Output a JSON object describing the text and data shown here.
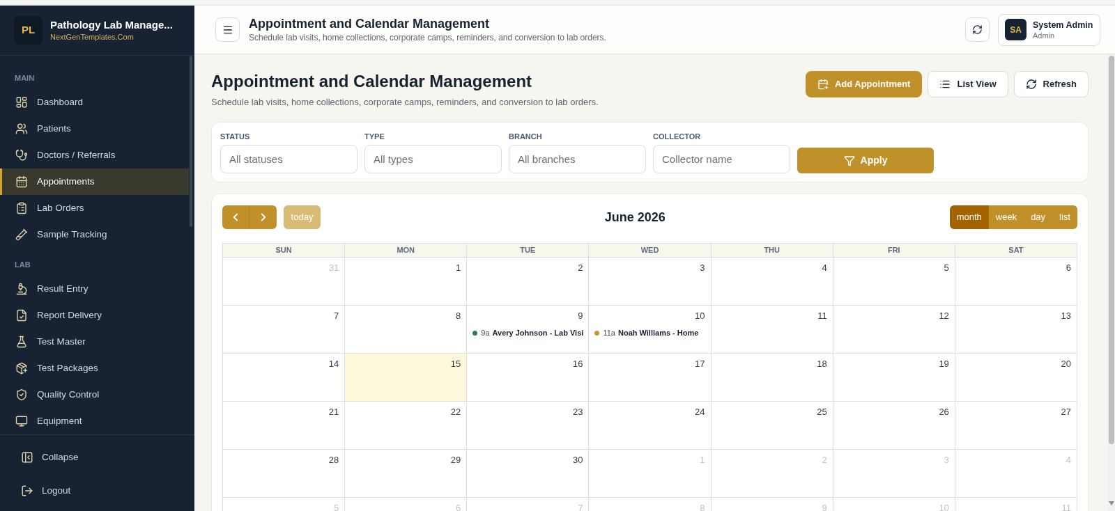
{
  "sidebar": {
    "logo": {
      "initials": "PL",
      "title": "Pathology Lab Manage...",
      "subtitle": "NextGenTemplates.Com"
    },
    "sections": [
      {
        "label": "MAIN",
        "items": [
          {
            "label": "Dashboard",
            "selected": false
          },
          {
            "label": "Patients",
            "selected": false
          },
          {
            "label": "Doctors / Referrals",
            "selected": false
          },
          {
            "label": "Appointments",
            "selected": true
          },
          {
            "label": "Lab Orders",
            "selected": false
          },
          {
            "label": "Sample Tracking",
            "selected": false
          }
        ]
      },
      {
        "label": "LAB",
        "items": [
          {
            "label": "Result Entry",
            "selected": false
          },
          {
            "label": "Report Delivery",
            "selected": false
          },
          {
            "label": "Test Master",
            "selected": false
          },
          {
            "label": "Test Packages",
            "selected": false
          },
          {
            "label": "Quality Control",
            "selected": false
          },
          {
            "label": "Equipment",
            "selected": false
          }
        ]
      }
    ],
    "footer": [
      {
        "label": "Collapse"
      },
      {
        "label": "Logout"
      }
    ]
  },
  "header": {
    "title": "Appointment and Calendar Management",
    "subtitle": "Schedule lab visits, home collections, corporate camps, reminders, and conversion to lab orders.",
    "user": {
      "initials": "SA",
      "name": "System Admin",
      "role": "Admin"
    }
  },
  "page": {
    "title": "Appointment and Calendar Management",
    "subtitle": "Schedule lab visits, home collections, corporate camps, reminders, and conversion to lab orders.",
    "actions": [
      {
        "label": "Add Appointment",
        "kind": "primary"
      },
      {
        "label": "List View",
        "kind": "secondary"
      },
      {
        "label": "Refresh",
        "kind": "secondary"
      }
    ]
  },
  "filters": {
    "fields": [
      {
        "label": "STATUS",
        "placeholder": "All statuses"
      },
      {
        "label": "TYPE",
        "placeholder": "All types"
      },
      {
        "label": "BRANCH",
        "placeholder": "All branches"
      },
      {
        "label": "COLLECTOR",
        "placeholder": "Collector name"
      }
    ],
    "apply": "Apply"
  },
  "calendar": {
    "title": "June 2026",
    "today_button": {
      "label": "today",
      "disabled": true
    },
    "views": [
      {
        "label": "month",
        "selected": true
      },
      {
        "label": "week",
        "selected": false
      },
      {
        "label": "day",
        "selected": false
      },
      {
        "label": "list",
        "selected": false
      }
    ],
    "weekdays": [
      "SUN",
      "MON",
      "TUE",
      "WED",
      "THU",
      "FRI",
      "SAT"
    ],
    "weeks": [
      [
        {
          "date": "31",
          "other_month": true,
          "today": false
        },
        {
          "date": "1",
          "other_month": false,
          "today": false
        },
        {
          "date": "2",
          "other_month": false,
          "today": false
        },
        {
          "date": "3",
          "other_month": false,
          "today": false
        },
        {
          "date": "4",
          "other_month": false,
          "today": false
        },
        {
          "date": "5",
          "other_month": false,
          "today": false
        },
        {
          "date": "6",
          "other_month": false,
          "today": false
        }
      ],
      [
        {
          "date": "7",
          "other_month": false,
          "today": false
        },
        {
          "date": "8",
          "other_month": false,
          "today": false
        },
        {
          "date": "9",
          "other_month": false,
          "today": false,
          "events": [
            {
              "time": "9a",
              "title": "Avery Johnson - Lab Visi",
              "color": "#2e7d5e"
            }
          ]
        },
        {
          "date": "10",
          "other_month": false,
          "today": false,
          "events": [
            {
              "time": "11a",
              "title": "Noah Williams - Home",
              "color": "#c9992f"
            }
          ]
        },
        {
          "date": "11",
          "other_month": false,
          "today": false
        },
        {
          "date": "12",
          "other_month": false,
          "today": false
        },
        {
          "date": "13",
          "other_month": false,
          "today": false
        }
      ],
      [
        {
          "date": "14",
          "other_month": false,
          "today": false
        },
        {
          "date": "15",
          "other_month": false,
          "today": true
        },
        {
          "date": "16",
          "other_month": false,
          "today": false
        },
        {
          "date": "17",
          "other_month": false,
          "today": false
        },
        {
          "date": "18",
          "other_month": false,
          "today": false
        },
        {
          "date": "19",
          "other_month": false,
          "today": false
        },
        {
          "date": "20",
          "other_month": false,
          "today": false
        }
      ],
      [
        {
          "date": "21",
          "other_month": false,
          "today": false
        },
        {
          "date": "22",
          "other_month": false,
          "today": false
        },
        {
          "date": "23",
          "other_month": false,
          "today": false
        },
        {
          "date": "24",
          "other_month": false,
          "today": false
        },
        {
          "date": "25",
          "other_month": false,
          "today": false
        },
        {
          "date": "26",
          "other_month": false,
          "today": false
        },
        {
          "date": "27",
          "other_month": false,
          "today": false
        }
      ],
      [
        {
          "date": "28",
          "other_month": false,
          "today": false
        },
        {
          "date": "29",
          "other_month": false,
          "today": false
        },
        {
          "date": "30",
          "other_month": false,
          "today": false
        },
        {
          "date": "1",
          "other_month": true,
          "today": false
        },
        {
          "date": "2",
          "other_month": true,
          "today": false
        },
        {
          "date": "3",
          "other_month": true,
          "today": false
        },
        {
          "date": "4",
          "other_month": true,
          "today": false
        }
      ],
      [
        {
          "date": "5",
          "other_month": true,
          "today": false
        },
        {
          "date": "6",
          "other_month": true,
          "today": false
        },
        {
          "date": "7",
          "other_month": true,
          "today": false
        },
        {
          "date": "8",
          "other_month": true,
          "today": false
        },
        {
          "date": "9",
          "other_month": true,
          "today": false
        },
        {
          "date": "10",
          "other_month": true,
          "today": false
        },
        {
          "date": "11",
          "other_month": true,
          "today": false
        }
      ]
    ]
  }
}
